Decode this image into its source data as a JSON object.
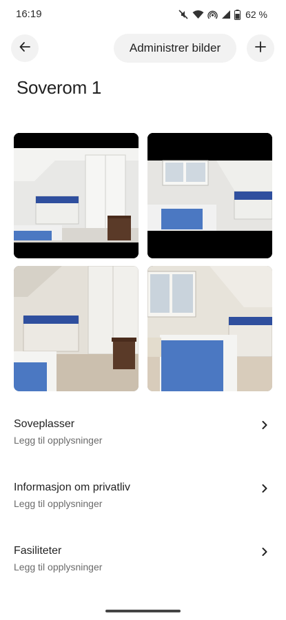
{
  "status": {
    "time": "16:19",
    "battery": "62 %",
    "icons": [
      "mute-icon",
      "wifi-icon",
      "hotspot-icon",
      "signal-icon",
      "battery-icon"
    ]
  },
  "header": {
    "back_icon": "arrow-left-icon",
    "manage_label": "Administrer bilder",
    "add_icon": "plus-icon"
  },
  "page": {
    "title": "Soverom 1"
  },
  "photos": [
    {
      "name": "bedroom-photo-1"
    },
    {
      "name": "bedroom-photo-2"
    },
    {
      "name": "bedroom-photo-3"
    },
    {
      "name": "bedroom-photo-4"
    }
  ],
  "sections": [
    {
      "title": "Soveplasser",
      "subtitle": "Legg til opplysninger"
    },
    {
      "title": "Informasjon om privatliv",
      "subtitle": "Legg til opplysninger"
    },
    {
      "title": "Fasiliteter",
      "subtitle": "Legg til opplysninger"
    }
  ],
  "colors": {
    "background": "#ffffff",
    "button_bg": "#f2f2f2",
    "text_primary": "#222222",
    "text_secondary": "#6a6a6a"
  }
}
